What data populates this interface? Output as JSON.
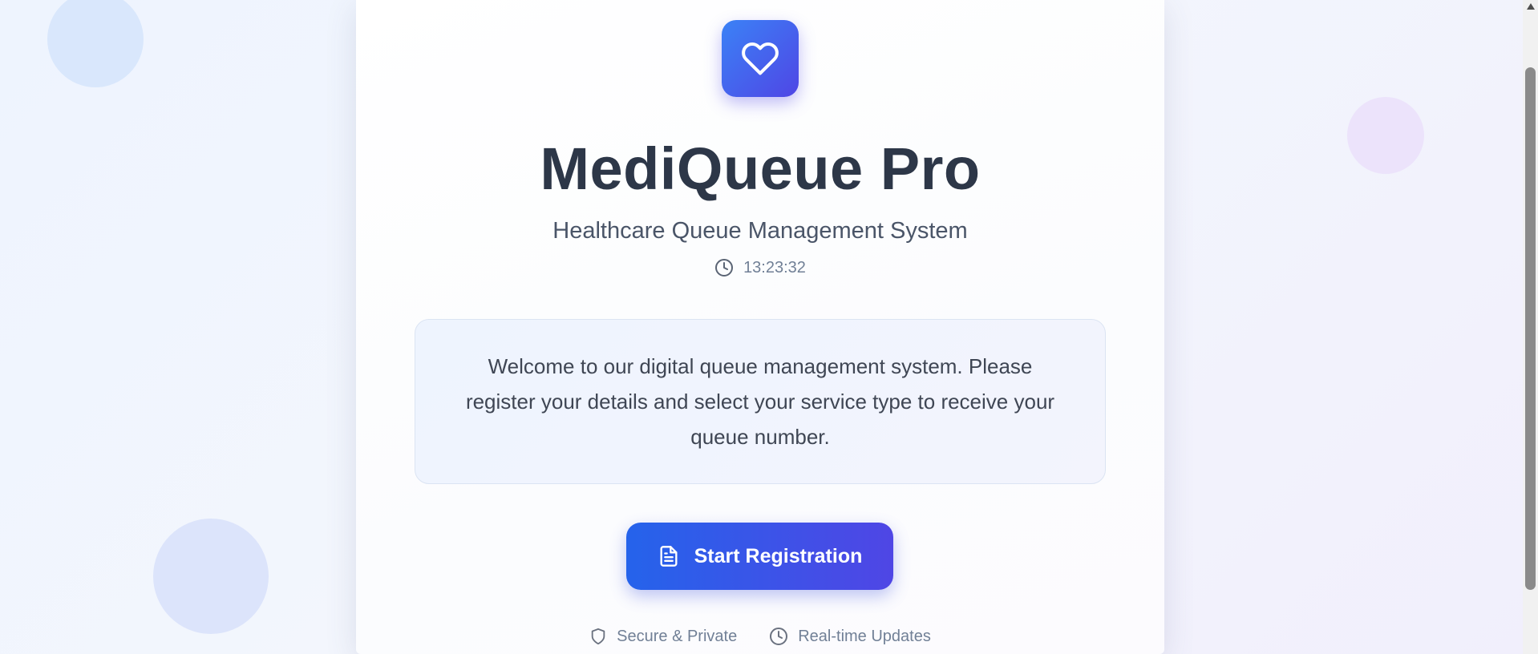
{
  "app": {
    "title": "MediQueue Pro",
    "subtitle": "Healthcare Queue Management System",
    "time": "13:23:32"
  },
  "welcome": {
    "message": "Welcome to our digital queue management system. Please register your details and select your service type to receive your queue number."
  },
  "actions": {
    "start_label": "Start Registration"
  },
  "features": {
    "secure_label": "Secure & Private",
    "realtime_label": "Real-time Updates"
  },
  "icons": {
    "logo": "heart-icon",
    "time": "clock-icon",
    "start": "document-icon",
    "secure": "shield-icon",
    "realtime": "clock-icon"
  },
  "colors": {
    "accent_start": "#2563eb",
    "accent_end": "#4f46e5",
    "title": "#2d3748",
    "muted": "#718096"
  }
}
